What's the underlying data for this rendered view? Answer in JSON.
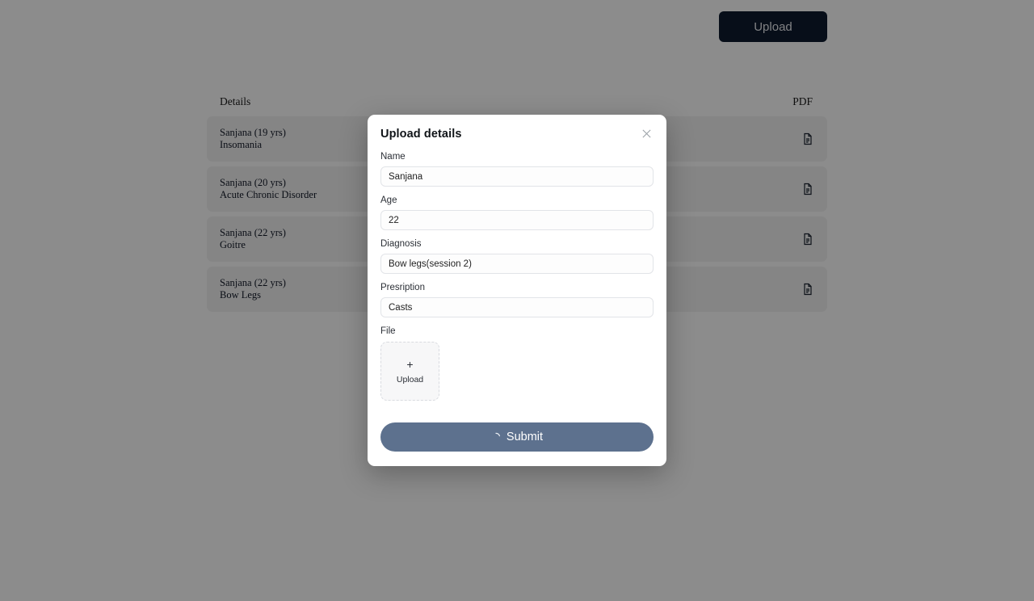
{
  "header": {
    "upload_button_label": "Upload"
  },
  "table": {
    "columns": {
      "details": "Details",
      "pdf": "PDF"
    },
    "rows": [
      {
        "patient": "Sanjana (19 yrs)",
        "condition": "Insomania",
        "pdf_icon": "document-icon"
      },
      {
        "patient": "Sanjana (20 yrs)",
        "condition": "Acute Chronic Disorder",
        "pdf_icon": "document-icon"
      },
      {
        "patient": "Sanjana (22 yrs)",
        "condition": "Goitre",
        "pdf_icon": "document-icon"
      },
      {
        "patient": "Sanjana (22 yrs)",
        "condition": "Bow Legs",
        "pdf_icon": "document-icon"
      }
    ]
  },
  "modal": {
    "title": "Upload details",
    "close_icon": "close-icon",
    "fields": {
      "name": {
        "label": "Name",
        "value": "Sanjana"
      },
      "age": {
        "label": "Age",
        "value": "22"
      },
      "diagnosis": {
        "label": "Diagnosis",
        "value": "Bow legs(session 2)"
      },
      "presription": {
        "label": "Presription",
        "value": "Casts"
      },
      "file": {
        "label": "File",
        "plus_icon": "plus-icon",
        "upload_label": "Upload"
      }
    },
    "submit": {
      "label": "Submit",
      "spinner_icon": "loading-spinner-icon"
    }
  },
  "colors": {
    "upload_button_bg": "#0d1b2f",
    "submit_button_bg": "#5d718e",
    "overlay": "rgba(0,0,0,0.45)",
    "row_bg": "#f2f2f2"
  }
}
